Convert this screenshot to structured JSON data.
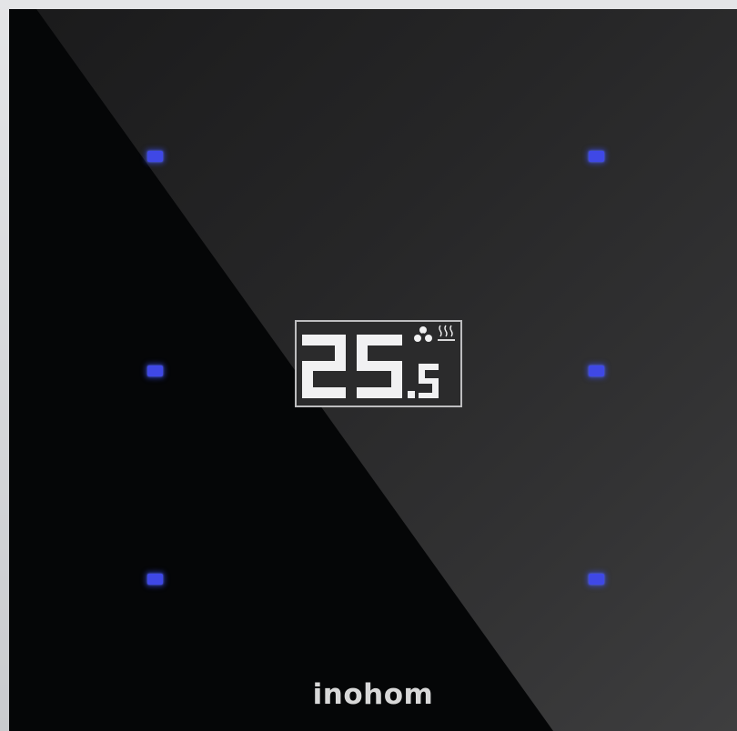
{
  "device": {
    "brand": "inohom",
    "display": {
      "temperature_integer": "25",
      "temperature_decimal": ".5"
    },
    "leds": [
      {
        "position": "top-left"
      },
      {
        "position": "top-right"
      },
      {
        "position": "middle-left"
      },
      {
        "position": "middle-right"
      },
      {
        "position": "bottom-left"
      },
      {
        "position": "bottom-right"
      }
    ],
    "icons": [
      "fan-icon",
      "heating-icon"
    ],
    "colors": {
      "glass_dark": "#050607",
      "glass_light": "#3e3e3f",
      "led_blue": "#3f48e6",
      "display_digits": "#f1f1f2",
      "display_bg": "#2b2b2c",
      "brand_text": "#d8d8d8",
      "frame": "#d3d4d6"
    }
  }
}
